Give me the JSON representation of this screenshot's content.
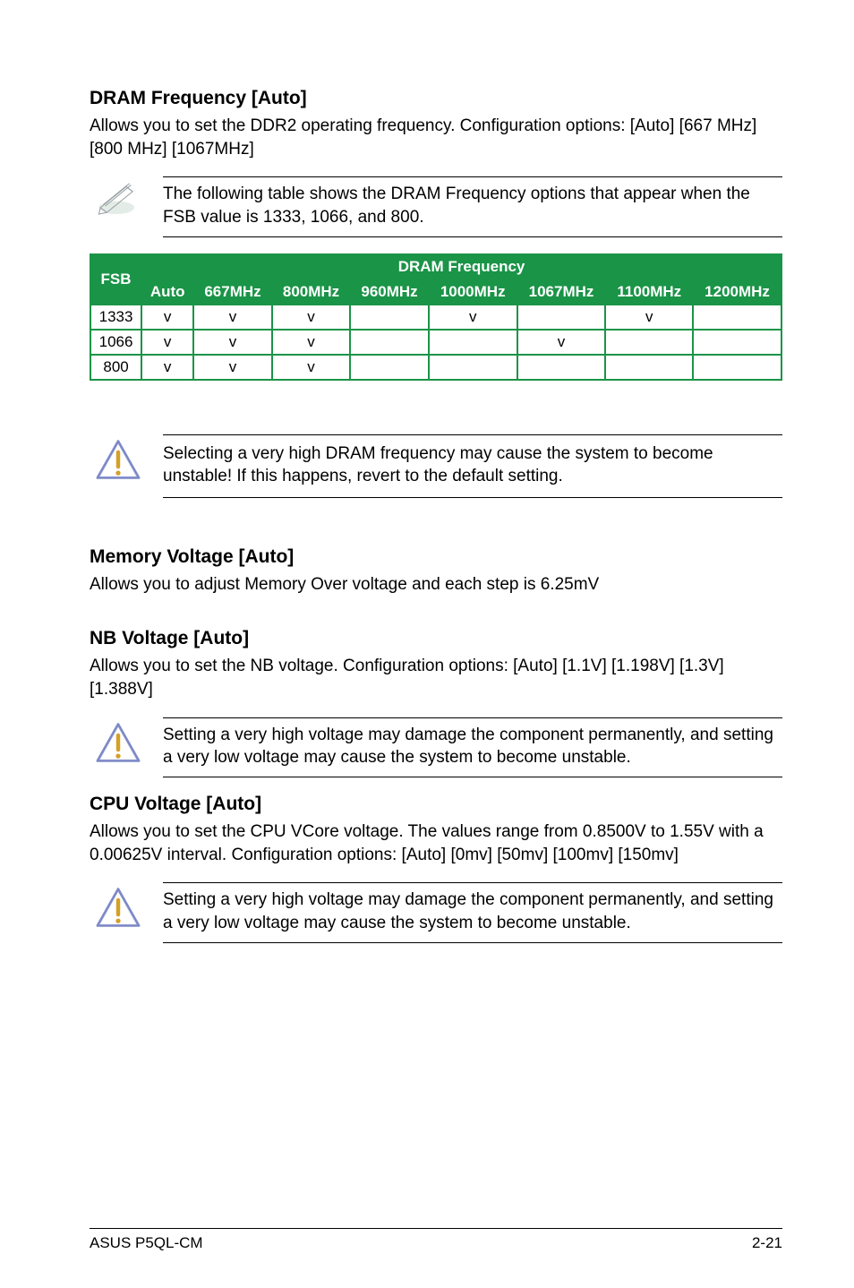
{
  "sections": {
    "dram_freq": {
      "heading": "DRAM Frequency [Auto]",
      "body": "Allows you to set the DDR2 operating frequency. Configuration options: [Auto] [667 MHz] [800 MHz] [1067MHz]"
    },
    "note_dram_table": "The following table shows the DRAM Frequency options that appear when the FSB value is 1333, 1066, and 800.",
    "warn_dram_high": "Selecting a very high DRAM frequency may cause the system to become unstable! If this happens, revert to the default setting.",
    "mem_voltage": {
      "heading": "Memory Voltage [Auto]",
      "body": "Allows you to adjust Memory Over voltage and each step is 6.25mV"
    },
    "nb_voltage": {
      "heading": "NB Voltage [Auto]",
      "body": "Allows you to set the NB voltage. Configuration options: [Auto] [1.1V] [1.198V] [1.3V] [1.388V]"
    },
    "warn_nb_voltage": "Setting a very high voltage may damage the component permanently, and setting a very low voltage may cause the system to become unstable.",
    "cpu_voltage": {
      "heading": "CPU Voltage [Auto]",
      "body": "Allows you to set the CPU VCore voltage. The values range from 0.8500V to 1.55V with a 0.00625V interval. Configuration options: [Auto] [0mv] [50mv] [100mv] [150mv]"
    },
    "warn_cpu_voltage": "Setting a very high voltage may damage the component permanently, and setting a very low voltage may cause the system to become unstable."
  },
  "chart_data": {
    "type": "table",
    "title": "DRAM Frequency",
    "row_header": "FSB",
    "columns": [
      "Auto",
      "667MHz",
      "800MHz",
      "960MHz",
      "1000MHz",
      "1067MHz",
      "1100MHz",
      "1200MHz"
    ],
    "rows": [
      {
        "fsb": "1333",
        "cells": [
          "v",
          "v",
          "v",
          "",
          "v",
          "",
          "v",
          ""
        ]
      },
      {
        "fsb": "1066",
        "cells": [
          "v",
          "v",
          "v",
          "",
          "",
          "v",
          "",
          ""
        ]
      },
      {
        "fsb": "800",
        "cells": [
          "v",
          "v",
          "v",
          "",
          "",
          "",
          "",
          ""
        ]
      }
    ]
  },
  "footer": {
    "left": "ASUS P5QL-CM",
    "right": "2-21"
  }
}
